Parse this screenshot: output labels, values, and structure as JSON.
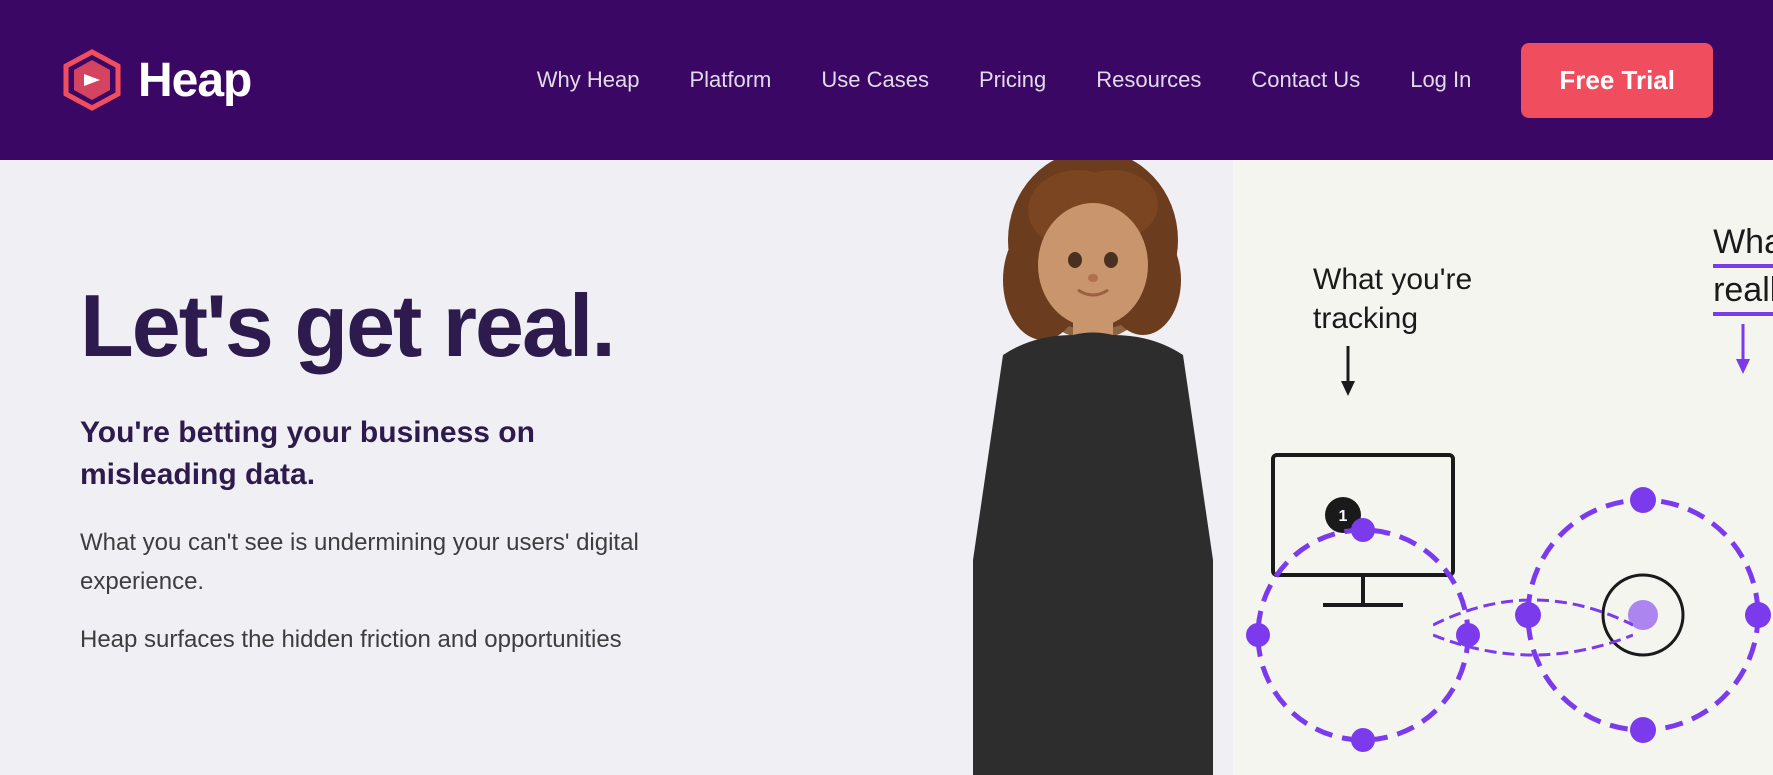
{
  "brand": {
    "name": "Heap",
    "logo_alt": "Heap logo"
  },
  "navbar": {
    "links": [
      {
        "label": "Why Heap",
        "id": "why-heap"
      },
      {
        "label": "Platform",
        "id": "platform"
      },
      {
        "label": "Use Cases",
        "id": "use-cases"
      },
      {
        "label": "Pricing",
        "id": "pricing"
      },
      {
        "label": "Resources",
        "id": "resources"
      },
      {
        "label": "Contact Us",
        "id": "contact-us"
      },
      {
        "label": "Log In",
        "id": "log-in"
      }
    ],
    "cta_label": "Free Trial"
  },
  "hero": {
    "headline": "Let's get real.",
    "subheadline": "You're betting your business on misleading data.",
    "body1": "What you can't see is undermining your users' digital experience.",
    "body2": "Heap surfaces the hidden friction and opportunities"
  },
  "colors": {
    "navbar_bg": "#3b0764",
    "cta_bg": "#f04e5e",
    "hero_bg": "#f0eff4",
    "headline_color": "#2d1b4e",
    "body_color": "#3d3d3d",
    "accent_purple": "#7c3aed"
  },
  "diagram": {
    "label1_line1": "What you're",
    "label1_line2": "tracking",
    "label2_line1": "Wha",
    "label2_line2": "reall"
  }
}
